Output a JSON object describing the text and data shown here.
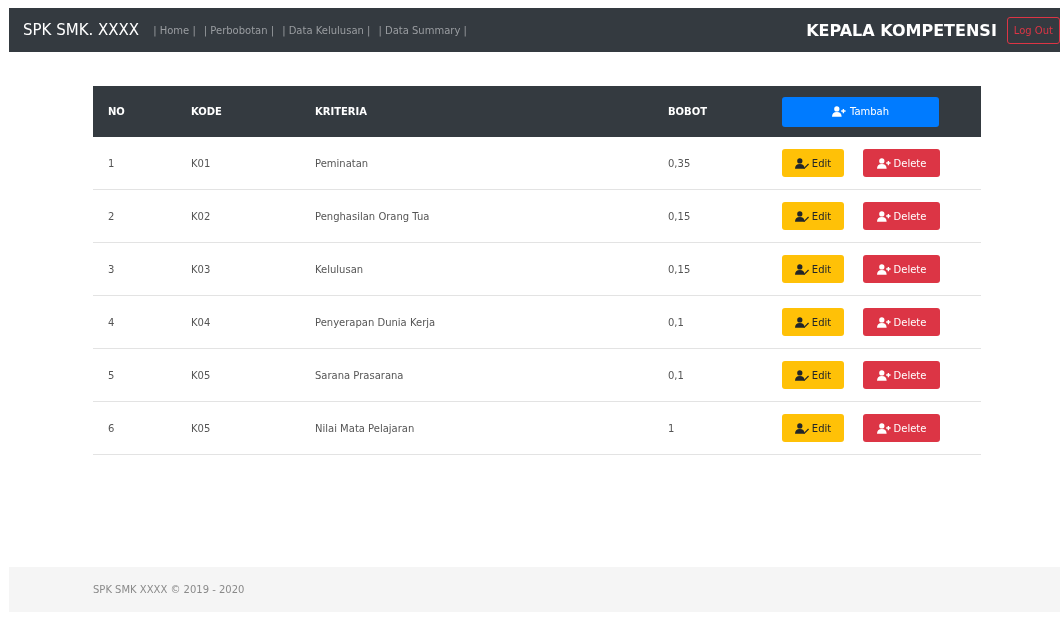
{
  "navbar": {
    "brand": "SPK SMK. XXXX",
    "links": [
      "| Home |",
      "| Perbobotan |",
      "| Data Kelulusan |",
      "| Data Summary |"
    ],
    "role": "KEPALA KOMPETENSI",
    "logout": "Log Out"
  },
  "table": {
    "columns": [
      "NO",
      "KODE",
      "KRITERIA",
      "BOBOT"
    ],
    "add_button": "Tambah",
    "rows": [
      {
        "no": "1",
        "kode": "K01",
        "kriteria": "Peminatan",
        "bobot": "0,35",
        "edit": "Edit",
        "delete": "Delete"
      },
      {
        "no": "2",
        "kode": "K02",
        "kriteria": "Penghasilan Orang Tua",
        "bobot": "0,15",
        "edit": "Edit",
        "delete": "Delete"
      },
      {
        "no": "3",
        "kode": "K03",
        "kriteria": "Kelulusan",
        "bobot": "0,15",
        "edit": "Edit",
        "delete": "Delete"
      },
      {
        "no": "4",
        "kode": "K04",
        "kriteria": "Penyerapan Dunia Kerja",
        "bobot": "0,1",
        "edit": "Edit",
        "delete": "Delete"
      },
      {
        "no": "5",
        "kode": "K05",
        "kriteria": "Sarana Prasarana",
        "bobot": "0,1",
        "edit": "Edit",
        "delete": "Delete"
      },
      {
        "no": "6",
        "kode": "K05",
        "kriteria": "Nilai Mata Pelajaran",
        "bobot": "1",
        "edit": "Edit",
        "delete": "Delete"
      }
    ]
  },
  "footer": "SPK SMK XXXX © 2019 - 2020"
}
